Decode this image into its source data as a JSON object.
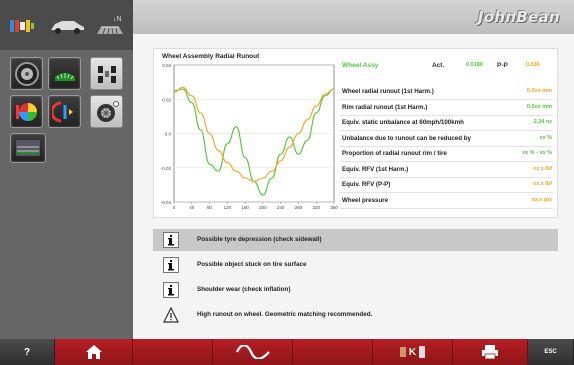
{
  "brand": {
    "logo_text": "JohnBean"
  },
  "chart": {
    "title": "Wheel Assembly Radial Runout",
    "y_ticks": [
      "0.04",
      "0.02",
      "0.0",
      "-0.02",
      "-0.04"
    ],
    "x_ticks": [
      "0",
      "40",
      "80",
      "120",
      "160",
      "200",
      "240",
      "280",
      "320",
      "360"
    ]
  },
  "chart_data": {
    "type": "line",
    "title": "Wheel Assembly Radial Runout",
    "xlabel": "",
    "ylabel": "",
    "xlim": [
      0,
      360
    ],
    "ylim": [
      -0.04,
      0.04
    ],
    "series": [
      {
        "name": "Wheel Assy",
        "color": "#4fc63b",
        "x": [
          0,
          20,
          40,
          60,
          80,
          100,
          120,
          140,
          160,
          180,
          200,
          220,
          240,
          260,
          280,
          300,
          320,
          340,
          360
        ],
        "y": [
          0.025,
          0.026,
          0.018,
          0.002,
          -0.018,
          -0.022,
          -0.006,
          0.004,
          -0.014,
          -0.028,
          -0.036,
          -0.026,
          -0.012,
          -0.002,
          -0.012,
          -0.004,
          0.012,
          0.022,
          0.026
        ]
      },
      {
        "name": "P-P",
        "color": "#f4a21e",
        "x": [
          0,
          20,
          40,
          60,
          80,
          100,
          120,
          140,
          160,
          180,
          200,
          220,
          240,
          260,
          280,
          300,
          320,
          340,
          360
        ],
        "y": [
          0.024,
          0.027,
          0.022,
          0.012,
          0.0,
          -0.01,
          -0.017,
          -0.022,
          -0.026,
          -0.028,
          -0.026,
          -0.022,
          -0.016,
          -0.008,
          0.0,
          0.008,
          0.016,
          0.023,
          0.026
        ]
      }
    ]
  },
  "legend": {
    "series_label": "Wheel Assy",
    "act_label": "Act.",
    "act_value": "0.0180",
    "pp_label": "P-P",
    "pp_value": "0.036"
  },
  "params": [
    {
      "label": "Wheel radial runout (1st Harm.)",
      "value": "0.0xx mm",
      "color": "orange"
    },
    {
      "label": "Rim radial runout (1st Harm.)",
      "value": "0.0xx mm",
      "color": "green"
    },
    {
      "label": "Equiv. static unbalance at 60mph/100kmh",
      "value": "2.34 oz",
      "color": "green"
    },
    {
      "label": "Unbalance due to runout can be reduced by",
      "value": "xx %",
      "color": "green"
    },
    {
      "label": "Proportion of radial runout rim / tire",
      "value": "xx % - xx %",
      "color": "green"
    },
    {
      "label": "Equiv. RFV (1st Harm.)",
      "value": "xx.x lbf",
      "color": "orange"
    },
    {
      "label": "Equiv. RFV (P-P)",
      "value": "xx.x lbf",
      "color": "orange"
    },
    {
      "label": "Wheel pressure",
      "value": "xx.x psi",
      "color": "orange"
    }
  ],
  "diagnostics": [
    {
      "text": "Possible tyre depression (check sidewall)",
      "icon": "info"
    },
    {
      "text": "Possible object stuck on tire surface",
      "icon": "info"
    },
    {
      "text": "Shoulder wear (check inflation)",
      "icon": "info"
    },
    {
      "text": "High runout on wheel. Geometric matching recommended.",
      "icon": "warning"
    }
  ],
  "bottom": {
    "help": "?",
    "k_label": "K",
    "esc": "ESC"
  },
  "colors": {
    "brand_red": "#b51f24",
    "green": "#4fc63b",
    "orange": "#f4a21e"
  }
}
